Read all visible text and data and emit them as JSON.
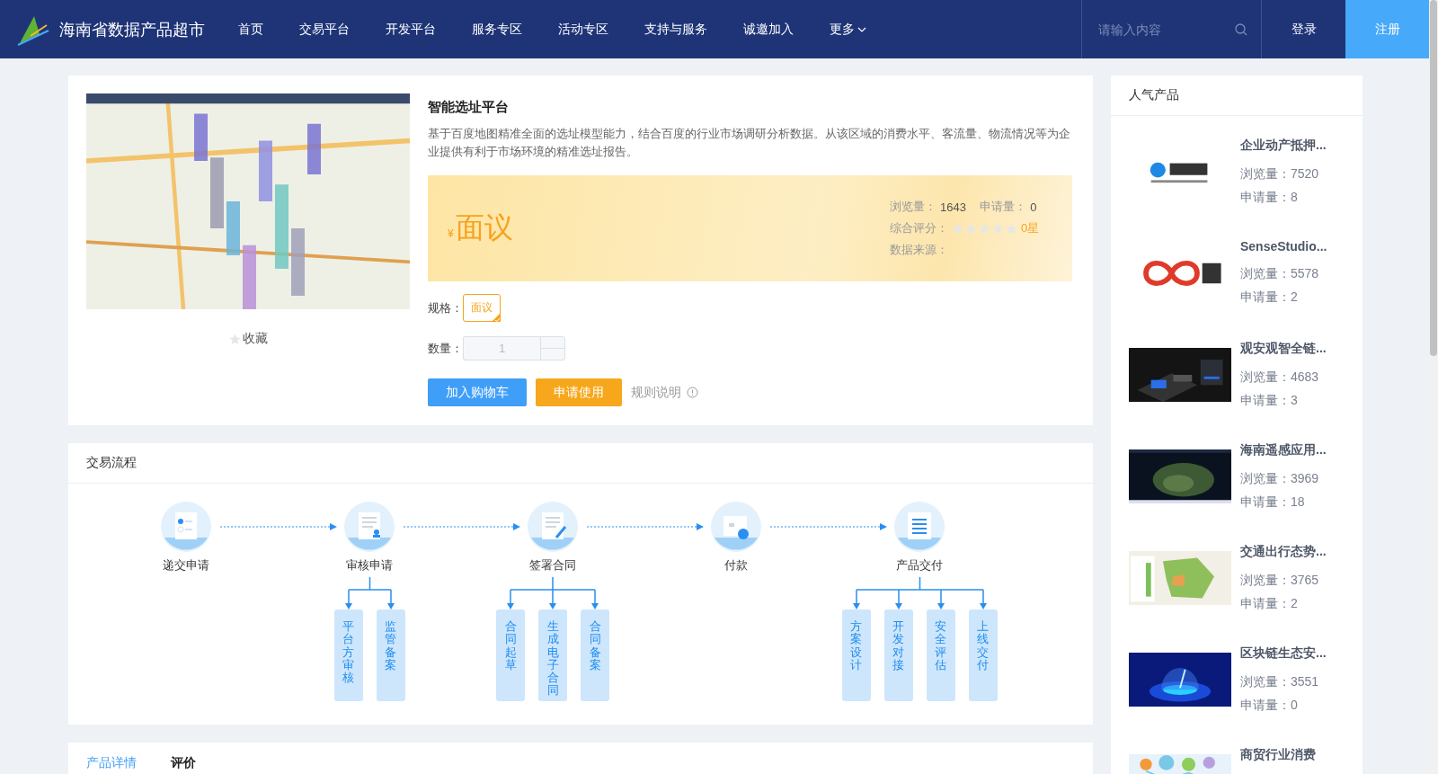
{
  "header": {
    "site_title": "海南省数据产品超市",
    "nav": [
      {
        "label": "首页",
        "menu": false
      },
      {
        "label": "交易平台",
        "menu": false
      },
      {
        "label": "开发平台",
        "menu": false
      },
      {
        "label": "服务专区",
        "menu": false
      },
      {
        "label": "活动专区",
        "menu": false
      },
      {
        "label": "支持与服务",
        "menu": false
      },
      {
        "label": "诚邀加入",
        "menu": false
      },
      {
        "label": "更多",
        "menu": true
      }
    ],
    "search": {
      "placeholder": "请输入内容"
    },
    "login": "登录",
    "register": "注册"
  },
  "product": {
    "favorite": "收藏",
    "favorited": false,
    "title": "智能选址平台",
    "description": "基于百度地图精准全面的选址模型能力，结合百度的行业市场调研分析数据。从该区域的消费水平、客流量、物流情况等为企业提供有利于市场环境的精准选址报告。",
    "currency": "¥",
    "price": "面议",
    "views_label": "浏览量：",
    "views": "1643",
    "applies_label": "申请量：",
    "applies": "0",
    "rating_label": "综合评分：",
    "stars": 0,
    "rating_text": "0星",
    "source_label": "数据来源：",
    "spec_label": "规格：",
    "specs": [
      {
        "label": "面议",
        "selected": true
      }
    ],
    "quantity_label": "数量：",
    "quantity": "1",
    "quantity_disabled": true,
    "buttons": [
      {
        "label": "加入购物车",
        "kind": "primary"
      },
      {
        "label": "申请使用",
        "kind": "warning"
      }
    ],
    "rules_link": "规则说明"
  },
  "flow": {
    "title": "交易流程",
    "steps": [
      {
        "label": "递交申请"
      },
      {
        "label": "审核申请",
        "children": [
          "平台方审核",
          "监管备案"
        ]
      },
      {
        "label": "签署合同",
        "children": [
          "合同起草",
          "生成电子合同",
          "合同备案"
        ]
      },
      {
        "label": "付款"
      },
      {
        "label": "产品交付",
        "children": [
          "方案设计",
          "开发对接",
          "安全评估",
          "上线交付"
        ]
      }
    ]
  },
  "tabs": [
    {
      "label": "产品详情",
      "selected": true
    },
    {
      "label": "评价",
      "selected": false
    }
  ],
  "hot": {
    "title": "人气产品",
    "items": [
      {
        "title": "企业动产抵押...",
        "views": "浏览量：7520",
        "applies": "申请量：8"
      },
      {
        "title": "SenseStudio...",
        "views": "浏览量：5578",
        "applies": "申请量：2"
      },
      {
        "title": "观安观智全链...",
        "views": "浏览量：4683",
        "applies": "申请量：3"
      },
      {
        "title": "海南遥感应用...",
        "views": "浏览量：3969",
        "applies": "申请量：18"
      },
      {
        "title": "交通出行态势...",
        "views": "浏览量：3765",
        "applies": "申请量：2"
      },
      {
        "title": "区块链生态安...",
        "views": "浏览量：3551",
        "applies": "申请量：0"
      },
      {
        "title": "商贸行业消费"
      }
    ]
  }
}
